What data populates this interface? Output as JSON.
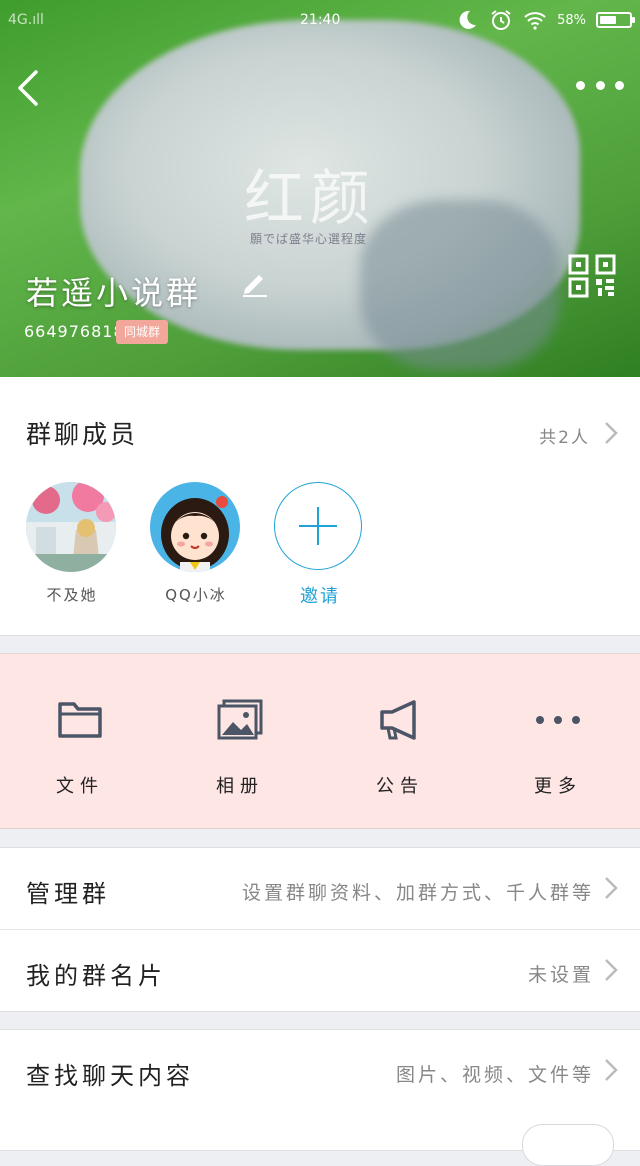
{
  "status_bar": {
    "carrier": "4G.ıll",
    "time": "21:40",
    "battery": "58%",
    "battery_level": 0.58
  },
  "header": {
    "watermark_title": "红颜",
    "watermark_subtitle": "願でば盛华心選程度",
    "group_name": "若遥小说群",
    "group_id": "664976818",
    "badge": "同城群"
  },
  "members": {
    "title": "群聊成员",
    "count": "共2人",
    "list": [
      {
        "name": "不及她",
        "avatar": "landscape-photo-avatar"
      },
      {
        "name": "QQ小冰",
        "avatar": "cartoon-girl-avatar"
      }
    ],
    "invite_label": "邀请"
  },
  "tools": [
    {
      "label": "文件",
      "icon": "folder-icon"
    },
    {
      "label": "相册",
      "icon": "album-icon"
    },
    {
      "label": "公告",
      "icon": "megaphone-icon"
    },
    {
      "label": "更多",
      "icon": "more-dots-icon"
    }
  ],
  "settings": {
    "manage": {
      "label": "管理群",
      "value": "设置群聊资料、加群方式、千人群等"
    },
    "card": {
      "label": "我的群名片",
      "value": "未设置"
    },
    "search": {
      "label": "查找聊天内容",
      "value": "图片、视频、文件等"
    }
  },
  "colors": {
    "accent": "#1fa2d6",
    "tools_background": "#fde6e4",
    "badge": "#f3a79a"
  }
}
